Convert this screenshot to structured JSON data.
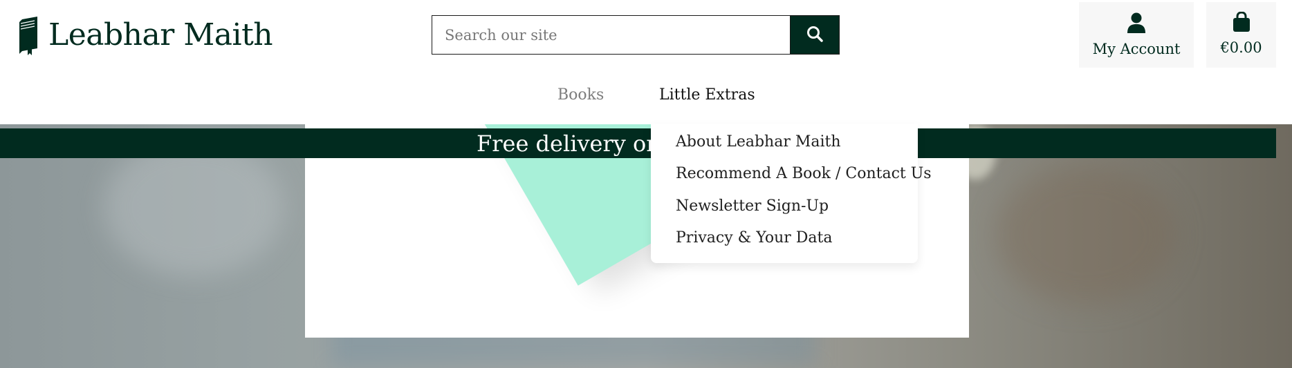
{
  "brand": {
    "name": "Leabhar Maith",
    "logo_icon": "book-icon",
    "color": "#012b1f"
  },
  "search": {
    "placeholder": "Search our site",
    "icon": "search-icon"
  },
  "account": {
    "label": "My Account",
    "icon": "user-icon"
  },
  "cart": {
    "label": "€0.00",
    "icon": "shopping-bag-icon"
  },
  "nav": {
    "items": [
      {
        "label": "Books"
      },
      {
        "label": "Little Extras"
      }
    ]
  },
  "dropdown": {
    "items": [
      {
        "label": "About Leabhar Maith"
      },
      {
        "label": "Recommend A Book / Contact Us"
      },
      {
        "label": "Newsletter Sign-Up"
      },
      {
        "label": "Privacy & Your Data"
      }
    ]
  },
  "banner": {
    "text": "Free delivery on or"
  },
  "colors": {
    "accent": "#012b1f",
    "book": "#a8f0d8"
  }
}
